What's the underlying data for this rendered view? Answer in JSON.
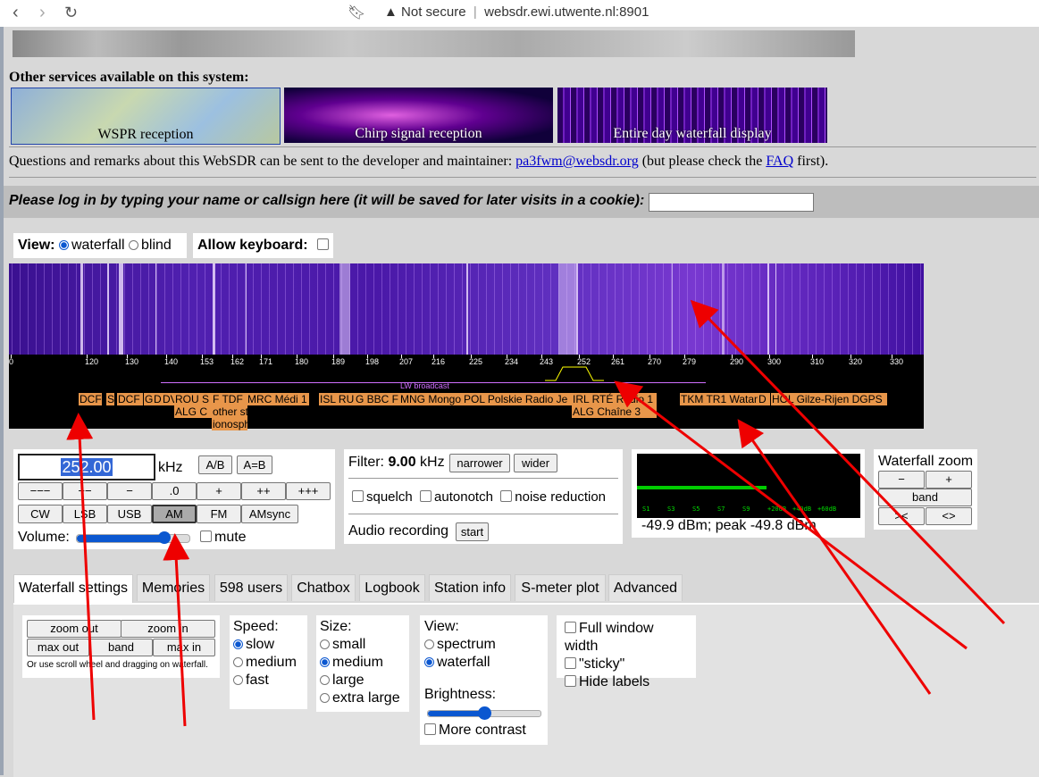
{
  "browser": {
    "security_text": "Not secure",
    "url": "websdr.ewi.utwente.nl:8901"
  },
  "services": {
    "title": "Other services available on this system:",
    "items": [
      "WSPR reception",
      "Chirp signal reception",
      "Entire day waterfall display"
    ]
  },
  "questions": {
    "prefix": "Questions and remarks about this WebSDR can be sent to the developer and maintainer: ",
    "email": "pa3fwm@websdr.org",
    "middle": " (but please check the ",
    "faq": "FAQ",
    "suffix": " first)."
  },
  "login": {
    "label": "Please log in by typing your name or callsign here (it will be saved for later visits in a cookie):",
    "value": ""
  },
  "view": {
    "label": "View:",
    "waterfall": "waterfall",
    "blind": "blind",
    "keyboard_label": "Allow keyboard:"
  },
  "scale": {
    "ticks": [
      "0",
      "120",
      "130",
      "140",
      "153",
      "162",
      "171",
      "180",
      "189",
      "198",
      "207",
      "216",
      "225",
      "234",
      "243",
      "252",
      "261",
      "270",
      "279",
      "290",
      "300",
      "310",
      "320",
      "330"
    ],
    "band_label": "LW broadcast",
    "stations_row1": [
      "DCF",
      "S",
      "DCF",
      "G",
      "D",
      "DV",
      "ROU S",
      "F TDF",
      "MRC Médi 1",
      "ISL RU",
      "G BBC F",
      "MNG Mongo",
      "POL Polskie Radio Je",
      "IRL RTÉ Radio 1",
      "TKM TR1 Watan",
      "D",
      "HOL Gilze-Rijen DGPS"
    ],
    "stations_row2": [
      "ALG C",
      "other st",
      "ALG Chaîne 3"
    ],
    "stations_row3": [
      "ionosph"
    ]
  },
  "tuning": {
    "frequency": "252.00",
    "unit": "kHz",
    "ab": "A/B",
    "aeqb": "A=B",
    "steps": [
      "−−−",
      "−−",
      "−",
      ".0",
      "+",
      "++",
      "+++"
    ],
    "modes": [
      "CW",
      "LSB",
      "USB",
      "AM",
      "FM",
      "AMsync"
    ],
    "active_mode": "AM",
    "volume_label": "Volume:",
    "volume_level": 0.78,
    "mute_label": "mute"
  },
  "filter": {
    "label": "Filter:",
    "value": "9.00",
    "unit": "kHz",
    "narrower": "narrower",
    "wider": "wider",
    "squelch": "squelch",
    "autonotch": "autonotch",
    "noise_reduction": "noise reduction",
    "recording_label": "Audio recording",
    "start": "start"
  },
  "smeter": {
    "scale": [
      "S1",
      "S3",
      "S5",
      "S7",
      "S9",
      "+20dB",
      "+40dB",
      "+60dB"
    ],
    "readout": "-49.9 dBm; peak  -49.8 dBm",
    "level": 0.58
  },
  "wfzoom": {
    "title": "Waterfall zoom",
    "minus": "−",
    "plus": "+",
    "band": "band",
    "left": "><",
    "right": "<>"
  },
  "tabs": [
    "Waterfall settings",
    "Memories",
    "598 users",
    "Chatbox",
    "Logbook",
    "Station info",
    "S-meter plot",
    "Advanced"
  ],
  "wfsettings": {
    "zoom_out": "zoom out",
    "zoom_in": "zoom in",
    "max_out": "max out",
    "band": "band",
    "max_in": "max in",
    "hint": "Or use scroll wheel and dragging on waterfall.",
    "speed_label": "Speed:",
    "speed": [
      "slow",
      "medium",
      "fast"
    ],
    "size_label": "Size:",
    "size": [
      "small",
      "medium",
      "large",
      "extra large"
    ],
    "view_label": "View:",
    "view": [
      "spectrum",
      "waterfall"
    ],
    "brightness_label": "Brightness:",
    "brightness_level": 0.5,
    "more_contrast": "More contrast",
    "full_width": "Full window width",
    "sticky": "\"sticky\"",
    "hide_labels": "Hide labels"
  },
  "colors": {
    "annotation_arrow": "#ee0000",
    "label_bg": "#e8964a",
    "smeter_bar": "#00cc00"
  }
}
